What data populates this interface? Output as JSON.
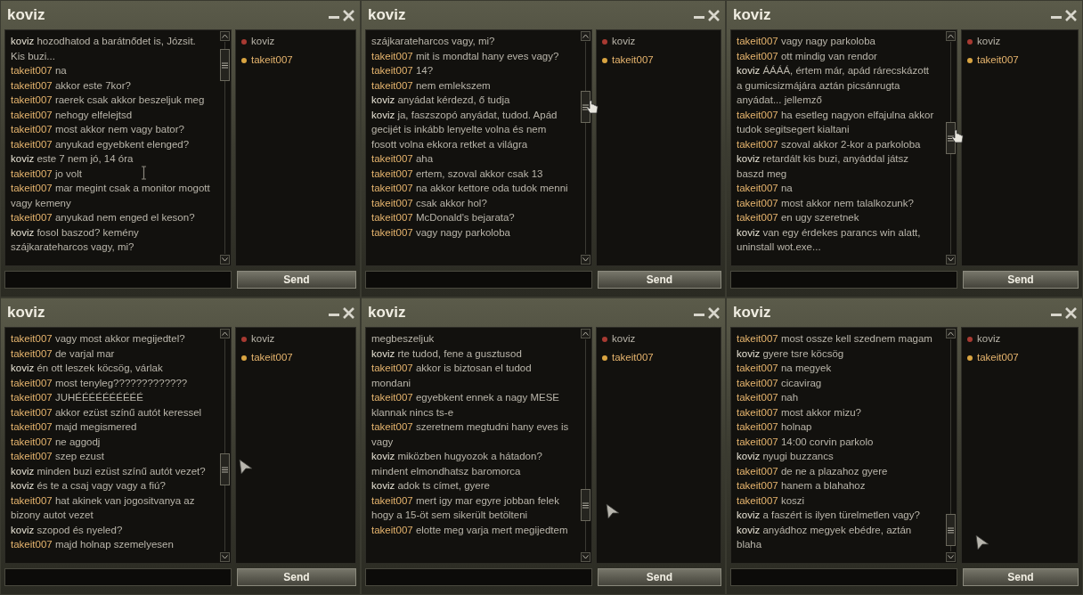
{
  "windows": [
    {
      "title": "koviz",
      "members": [
        {
          "name": "koviz",
          "color": "#a83a32"
        },
        {
          "name": "takeit007",
          "color": "#d9a441"
        }
      ],
      "send": "Send",
      "messages": [
        {
          "sender": "koviz",
          "color": "#e6e1d3",
          "text": "hozodhatod a barátnődet is, Józsit. Kis buzi..."
        },
        {
          "sender": "takeit007",
          "color": "#e7b56e",
          "text": "na"
        },
        {
          "sender": "takeit007",
          "color": "#e7b56e",
          "text": "akkor este 7kor?"
        },
        {
          "sender": "takeit007",
          "color": "#e7b56e",
          "text": "raerek csak akkor beszeljuk meg"
        },
        {
          "sender": "takeit007",
          "color": "#e7b56e",
          "text": "nehogy elfelejtsd"
        },
        {
          "sender": "takeit007",
          "color": "#e7b56e",
          "text": "most akkor nem vagy bator?"
        },
        {
          "sender": "takeit007",
          "color": "#e7b56e",
          "text": "anyukad egyebkent elenged?"
        },
        {
          "sender": "koviz",
          "color": "#e6e1d3",
          "text": "este 7 nem jó, 14 óra"
        },
        {
          "sender": "takeit007",
          "color": "#e7b56e",
          "text": "jo volt"
        },
        {
          "sender": "takeit007",
          "color": "#e7b56e",
          "text": "mar megint csak a monitor mogott vagy kemeny"
        },
        {
          "sender": "takeit007",
          "color": "#e7b56e",
          "text": "anyukad nem enged el keson?"
        },
        {
          "sender": "koviz",
          "color": "#e6e1d3",
          "text": "fosol baszod? kemény szájkarateharcos vagy, mi?"
        }
      ]
    },
    {
      "title": "koviz",
      "members": [
        {
          "name": "koviz",
          "color": "#a83a32"
        },
        {
          "name": "takeit007",
          "color": "#d9a441"
        }
      ],
      "send": "Send",
      "messages": [
        {
          "text": "szájkarateharcos vagy, mi?"
        },
        {
          "sender": "takeit007",
          "color": "#e7b56e",
          "text": "mit is mondtal hany eves vagy?"
        },
        {
          "sender": "takeit007",
          "color": "#e7b56e",
          "text": "14?"
        },
        {
          "sender": "takeit007",
          "color": "#e7b56e",
          "text": "nem emlekszem"
        },
        {
          "sender": "koviz",
          "color": "#e6e1d3",
          "text": "anyádat kérdezd, ő tudja"
        },
        {
          "sender": "koviz",
          "color": "#e6e1d3",
          "text": "ja, faszszopó anyádat, tudod. Apád gecijét is inkább lenyelte volna és nem fosott volna ekkora retket a világra"
        },
        {
          "sender": "takeit007",
          "color": "#e7b56e",
          "text": "aha"
        },
        {
          "sender": "takeit007",
          "color": "#e7b56e",
          "text": "ertem, szoval akkor csak 13"
        },
        {
          "sender": "takeit007",
          "color": "#e7b56e",
          "text": "na akkor kettore oda tudok menni"
        },
        {
          "sender": "takeit007",
          "color": "#e7b56e",
          "text": "csak akkor hol?"
        },
        {
          "sender": "takeit007",
          "color": "#e7b56e",
          "text": "McDonald's bejarata?"
        },
        {
          "sender": "takeit007",
          "color": "#e7b56e",
          "text": "vagy nagy parkoloba"
        }
      ]
    },
    {
      "title": "koviz",
      "members": [
        {
          "name": "koviz",
          "color": "#a83a32"
        },
        {
          "name": "takeit007",
          "color": "#d9a441"
        }
      ],
      "send": "Send",
      "messages": [
        {
          "sender": "takeit007",
          "color": "#e7b56e",
          "text": "vagy nagy parkoloba"
        },
        {
          "sender": "takeit007",
          "color": "#e7b56e",
          "text": "ott mindig van rendor"
        },
        {
          "sender": "koviz",
          "color": "#e6e1d3",
          "text": "ÁÁÁÁ, értem már, apád rárecskázott a gumicsizmájára aztán picsánrugta anyádat... jellemző"
        },
        {
          "sender": "takeit007",
          "color": "#e7b56e",
          "text": "ha esetleg nagyon elfajulna akkor tudok segitsegert kialtani"
        },
        {
          "sender": "takeit007",
          "color": "#e7b56e",
          "text": "szoval akkor 2-kor a parkoloba"
        },
        {
          "sender": "koviz",
          "color": "#e6e1d3",
          "text": "retardált kis buzi, anyáddal játsz baszd meg"
        },
        {
          "sender": "takeit007",
          "color": "#e7b56e",
          "text": "na"
        },
        {
          "sender": "takeit007",
          "color": "#e7b56e",
          "text": "most akkor nem talalkozunk?"
        },
        {
          "sender": "takeit007",
          "color": "#e7b56e",
          "text": "en ugy szeretnek"
        },
        {
          "sender": "koviz",
          "color": "#e6e1d3",
          "text": "van egy érdekes parancs win alatt, uninstall wot.exe..."
        }
      ]
    },
    {
      "title": "koviz",
      "members": [
        {
          "name": "koviz",
          "color": "#a83a32"
        },
        {
          "name": "takeit007",
          "color": "#d9a441"
        }
      ],
      "send": "Send",
      "messages": [
        {
          "sender": "takeit007",
          "color": "#e7b56e",
          "text": "vagy most akkor megijedtel?"
        },
        {
          "sender": "takeit007",
          "color": "#e7b56e",
          "text": "de varjal mar"
        },
        {
          "sender": "koviz",
          "color": "#e6e1d3",
          "text": "én ott leszek köcsög, várlak"
        },
        {
          "sender": "takeit007",
          "color": "#e7b56e",
          "text": "most tenyleg?????????????"
        },
        {
          "sender": "takeit007",
          "color": "#e7b56e",
          "text": "JUHÉÉÉÉÉÉÉÉÉÉ"
        },
        {
          "sender": "takeit007",
          "color": "#e7b56e",
          "text": "akkor ezüst színű autót keressel"
        },
        {
          "sender": "takeit007",
          "color": "#e7b56e",
          "text": "majd megismered"
        },
        {
          "sender": "takeit007",
          "color": "#e7b56e",
          "text": "ne aggodj"
        },
        {
          "sender": "takeit007",
          "color": "#e7b56e",
          "text": "szep ezust"
        },
        {
          "sender": "koviz",
          "color": "#e6e1d3",
          "text": "minden buzi ezüst színű autót vezet?"
        },
        {
          "sender": "koviz",
          "color": "#e6e1d3",
          "text": "és te a csaj vagy vagy a fiú?"
        },
        {
          "sender": "takeit007",
          "color": "#e7b56e",
          "text": "hat akinek van jogositvanya az bizony autot vezet"
        },
        {
          "sender": "koviz",
          "color": "#e6e1d3",
          "text": "szopod és nyeled?"
        },
        {
          "sender": "takeit007",
          "color": "#e7b56e",
          "text": "majd holnap szemelyesen"
        }
      ]
    },
    {
      "title": "koviz",
      "members": [
        {
          "name": "koviz",
          "color": "#a83a32"
        },
        {
          "name": "takeit007",
          "color": "#d9a441"
        }
      ],
      "send": "Send",
      "messages": [
        {
          "text": "megbeszeljuk"
        },
        {
          "sender": "koviz",
          "color": "#e6e1d3",
          "text": "rte tudod, fene a gusztusod"
        },
        {
          "sender": "takeit007",
          "color": "#e7b56e",
          "text": "akkor is biztosan el tudod mondani"
        },
        {
          "sender": "takeit007",
          "color": "#e7b56e",
          "text": "egyebkent ennek a nagy MESE klannak nincs ts-e"
        },
        {
          "sender": "takeit007",
          "color": "#e7b56e",
          "text": "szeretnem megtudni hany eves is vagy"
        },
        {
          "sender": "koviz",
          "color": "#e6e1d3",
          "text": "miközben hugyozok a hátadon? mindent elmondhatsz baromorca"
        },
        {
          "sender": "koviz",
          "color": "#e6e1d3",
          "text": "adok ts címet, gyere"
        },
        {
          "sender": "takeit007",
          "color": "#e7b56e",
          "text": "mert igy mar egyre jobban felek hogy a 15-öt sem sikerült betölteni"
        },
        {
          "sender": "takeit007",
          "color": "#e7b56e",
          "text": "elotte meg varja mert megijedtem"
        }
      ]
    },
    {
      "title": "koviz",
      "members": [
        {
          "name": "koviz",
          "color": "#a83a32"
        },
        {
          "name": "takeit007",
          "color": "#d9a441"
        }
      ],
      "send": "Send",
      "messages": [
        {
          "sender": "takeit007",
          "color": "#e7b56e",
          "text": "most ossze kell szednem magam"
        },
        {
          "sender": "koviz",
          "color": "#e6e1d3",
          "text": "gyere tsre köcsög"
        },
        {
          "sender": "takeit007",
          "color": "#e7b56e",
          "text": "na megyek"
        },
        {
          "sender": "takeit007",
          "color": "#e7b56e",
          "text": "cicavirag"
        },
        {
          "sender": "takeit007",
          "color": "#e7b56e",
          "text": "nah"
        },
        {
          "sender": "takeit007",
          "color": "#e7b56e",
          "text": "most akkor mizu?"
        },
        {
          "sender": "takeit007",
          "color": "#e7b56e",
          "text": "holnap"
        },
        {
          "sender": "takeit007",
          "color": "#e7b56e",
          "text": "14:00 corvin parkolo"
        },
        {
          "sender": "koviz",
          "color": "#e6e1d3",
          "text": "nyugi buzzancs"
        },
        {
          "sender": "takeit007",
          "color": "#e7b56e",
          "text": "de ne a plazahoz gyere"
        },
        {
          "sender": "takeit007",
          "color": "#e7b56e",
          "text": "hanem a blahahoz"
        },
        {
          "sender": "takeit007",
          "color": "#e7b56e",
          "text": "koszi"
        },
        {
          "sender": "koviz",
          "color": "#e6e1d3",
          "text": "a faszért is ilyen türelmetlen vagy?"
        },
        {
          "sender": "koviz",
          "color": "#e6e1d3",
          "text": "anyádhoz megyek ebédre, aztán blaha"
        }
      ]
    }
  ]
}
